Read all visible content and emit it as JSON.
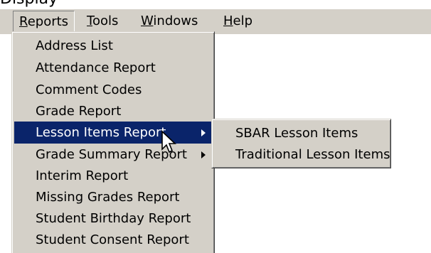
{
  "top_fragment": "Display",
  "menubar": {
    "items": [
      {
        "accel": "R",
        "rest": "eports",
        "active": true
      },
      {
        "accel": "T",
        "rest": "ools",
        "active": false
      },
      {
        "accel": "W",
        "rest": "indows",
        "active": false
      },
      {
        "accel": "H",
        "rest": "elp",
        "active": false
      }
    ]
  },
  "reports_menu": {
    "items": [
      {
        "label": "Address List"
      },
      {
        "label": "Attendance Report"
      },
      {
        "label": "Comment Codes"
      },
      {
        "label": "Grade Report"
      },
      {
        "label": "Lesson Items Report",
        "has_submenu": true,
        "highlighted": true
      },
      {
        "label": "Grade Summary Report",
        "has_submenu": true
      },
      {
        "label": "Interim Report"
      },
      {
        "label": "Missing Grades Report"
      },
      {
        "label": "Student Birthday Report"
      },
      {
        "label": "Student Consent Report"
      }
    ]
  },
  "lesson_items_submenu": {
    "items": [
      {
        "label": "SBAR Lesson Items"
      },
      {
        "label": "Traditional Lesson Items"
      }
    ]
  },
  "colors": {
    "menu_face": "#d4d0c8",
    "highlight": "#0a246a",
    "highlight_text": "#ffffff"
  },
  "icons": {
    "submenu_arrow": "triangle-right",
    "mouse_cursor": "arrow-pointer"
  }
}
